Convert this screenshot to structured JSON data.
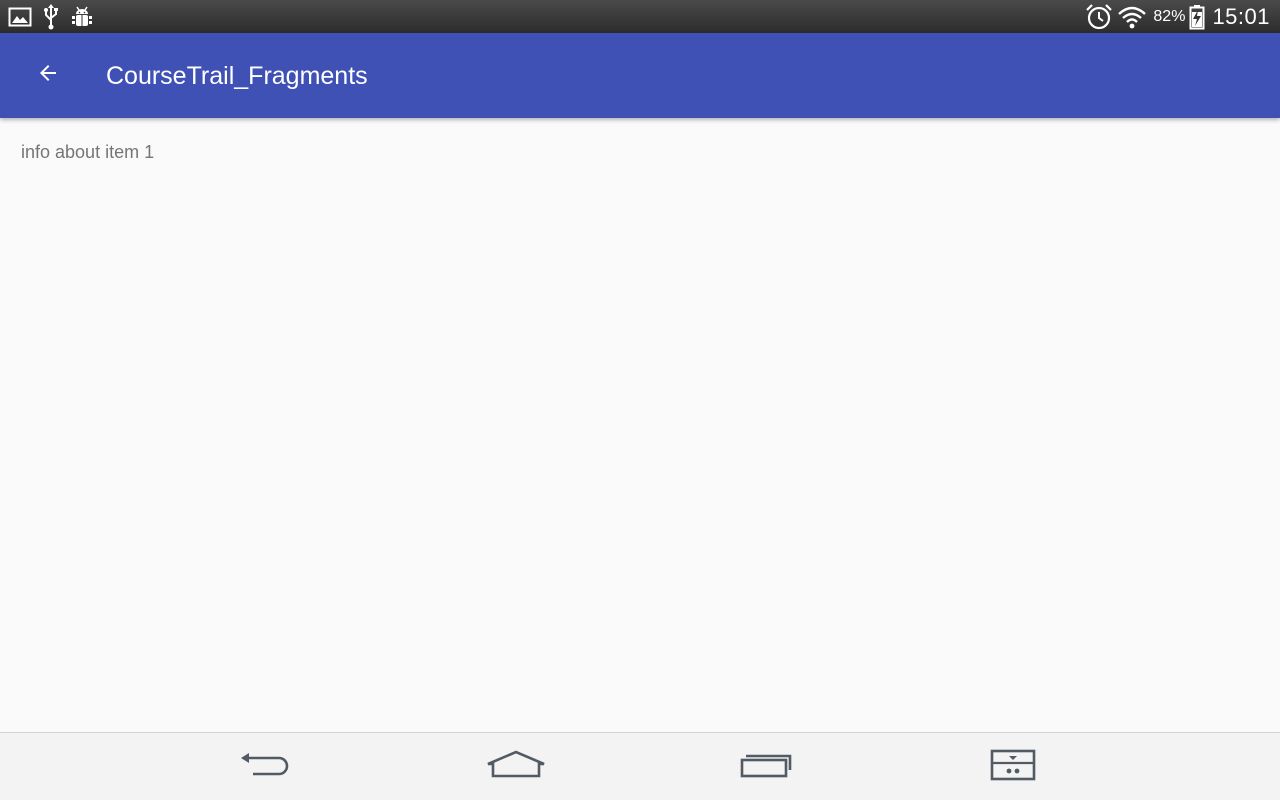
{
  "status_bar": {
    "left_icons": [
      "gallery-icon",
      "usb-icon",
      "android-debug-icon"
    ],
    "right_icons": [
      "alarm-icon",
      "wifi-icon",
      "battery-charging-icon"
    ],
    "battery_percent": "82%",
    "time": "15:01"
  },
  "app_bar": {
    "back_icon": "arrow-back-icon",
    "title": "CourseTrail_Fragments",
    "color": "#3f51b5"
  },
  "content": {
    "text": "info about item 1"
  },
  "nav_bar": {
    "buttons": [
      "back-icon",
      "home-icon",
      "recent-apps-icon",
      "split-screen-icon"
    ]
  }
}
